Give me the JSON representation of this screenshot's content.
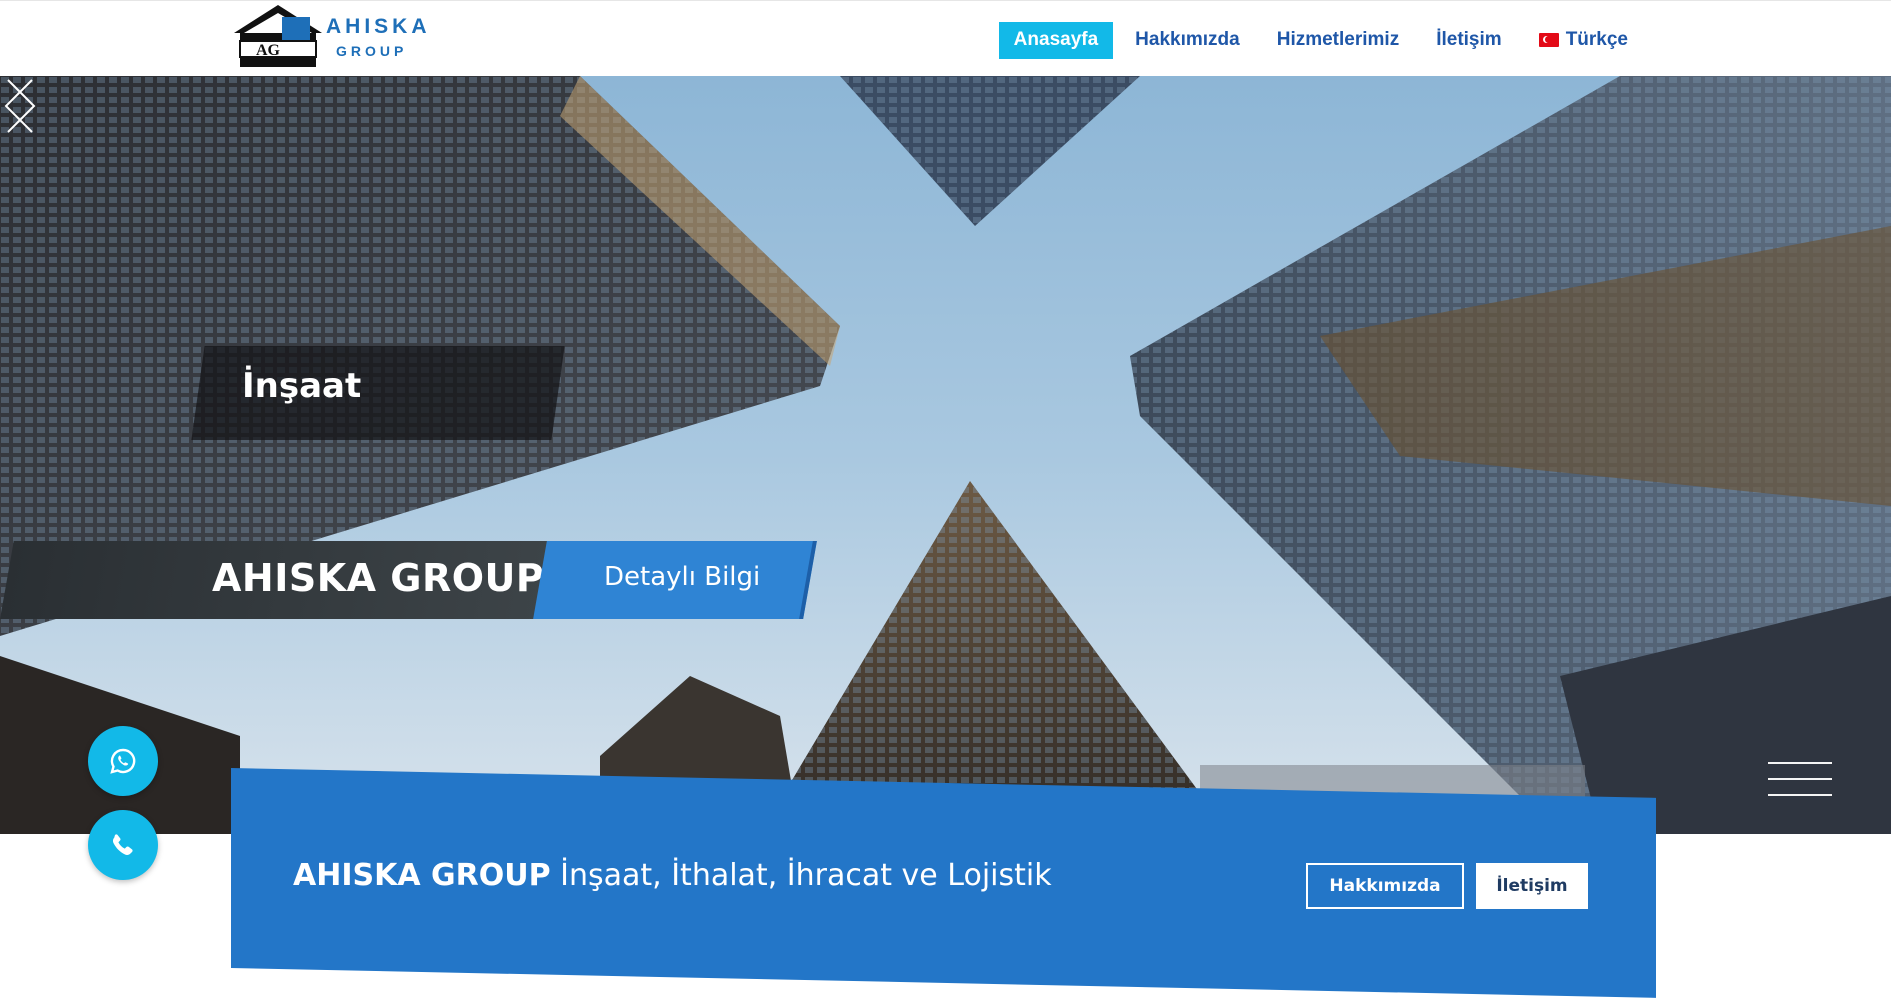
{
  "brand": {
    "logo_letters": "AG",
    "name": "AHISKA",
    "sub": "GROUP",
    "color": "#1e6fb8"
  },
  "nav": {
    "items": [
      {
        "label": "Anasayfa",
        "active": true
      },
      {
        "label": "Hakkımızda",
        "active": false
      },
      {
        "label": "Hizmetlerimiz",
        "active": false
      },
      {
        "label": "İletişim",
        "active": false
      }
    ],
    "language": {
      "label": "Türkçe",
      "icon": "turkey-flag-icon"
    }
  },
  "hero": {
    "slide_caption": "İnşaat",
    "brand_band": "AHISKA GROUP",
    "detail_button": "Detaylı Bilgi",
    "prev_icon": "chevron-left-icon",
    "next_icon": "chevron-right-icon"
  },
  "cta": {
    "title_bold": "AHISKA GROUP",
    "title_rest": " İnşaat, İthalat, İhracat ve Lojistik",
    "about_button": "Hakkımızda",
    "contact_button": "İletişim"
  },
  "floating": {
    "whatsapp_icon": "whatsapp-icon",
    "phone_icon": "phone-icon"
  },
  "colors": {
    "accent": "#12b9e8",
    "nav_text": "#1f57a8",
    "cta_bg": "#2376c8",
    "detail_button": "#2f84d4"
  }
}
